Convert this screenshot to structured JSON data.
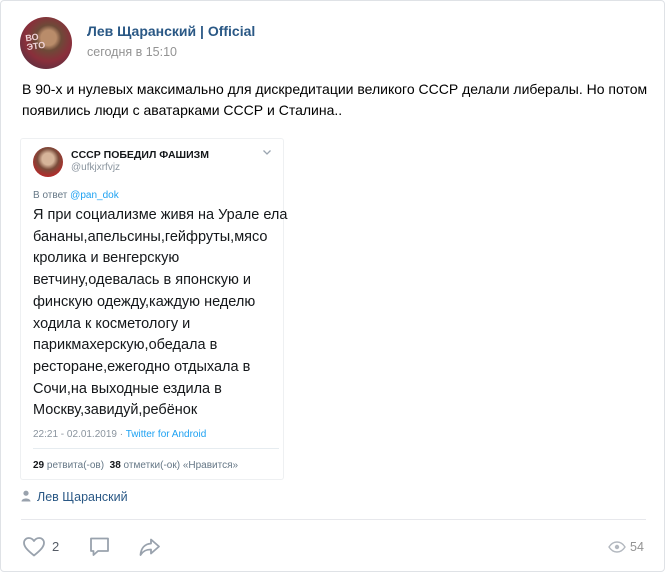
{
  "post": {
    "author": "Лев Щаранский | Official",
    "time": "сегодня в 15:10",
    "text": "В 90-х и нулевых максимально для дискредитации великого СССР делали либералы. Но потом появились люди с аватарками СССР и Сталина..",
    "signature": "Лев Щаранский"
  },
  "tweet": {
    "display_name": "СССР ПОБЕДИЛ ФАШИЗМ",
    "handle": "@ufkjxrfvjz",
    "reply_prefix": "В ответ",
    "reply_handle": "@pan_dok",
    "body_lines": [
      "Я при социализме живя на Урале ела",
      "бананы,апельсины,гейфруты,мясо",
      "кролика и венгерскую",
      "ветчину,одевалась в японскую и",
      "финскую  одежду,каждую неделю",
      "ходила к косметологу и",
      "парикмахерскую,обедала в",
      "ресторане,ежегодно отдыхала в",
      "Сочи,на выходные ездила в",
      "Москву,завидуй,ребёнок"
    ],
    "timestamp": "22:21 - 02.01.2019 ·",
    "source": "Twitter for Android",
    "retweets_count": "29",
    "retweets_label": "ретвита(-ов)",
    "likes_count": "38",
    "likes_label": "отметки(-ок) «Нравится»"
  },
  "actions": {
    "likes": "2",
    "views": "54"
  },
  "colors": {
    "link": "#2a5885",
    "muted": "#939393",
    "twitter_blue": "#1da1f2",
    "icon": "#99a2ad"
  },
  "icons": [
    "heart-icon",
    "comment-icon",
    "share-icon",
    "eye-icon",
    "person-icon",
    "chevron-down-icon"
  ]
}
